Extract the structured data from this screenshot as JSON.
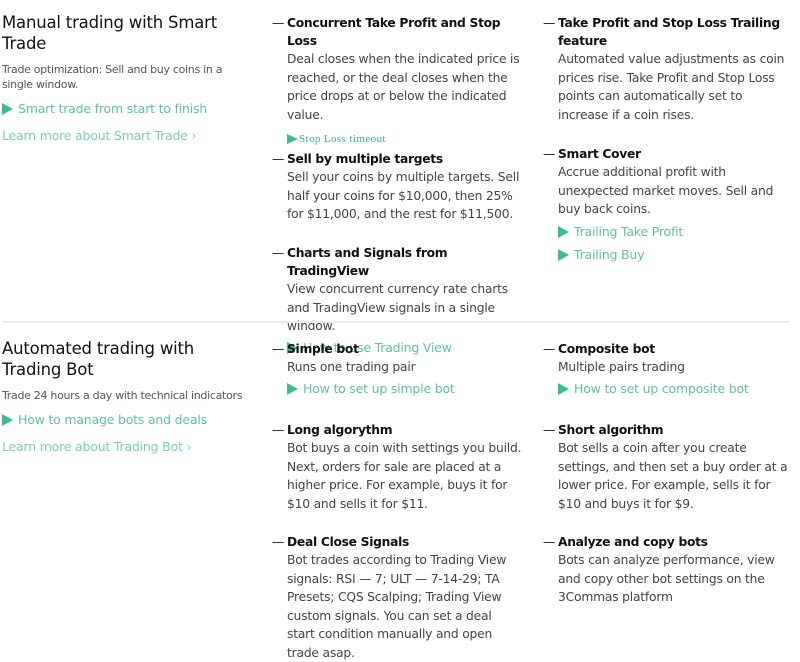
{
  "sections": [
    {
      "title": "Manual trading with Smart Trade",
      "subtitle": "Trade optimization: Sell and buy coins in a single window.",
      "video_link": "Smart trade from start to finish",
      "learn_more": "Learn more about Smart Trade",
      "learn_more_chevron": "›",
      "features": [
        {
          "title": "Concurrent Take Profit and Stop Loss",
          "description": "Deal closes when the indicated price is reached, or the deal closes when the price drops at or below the indicated value.",
          "links": [
            "Stop Loss timeout"
          ]
        },
        {
          "title": "Take Profit and Stop Loss Trailing feature",
          "description": "Automated value adjustments as coin prices rise. Take Profit and Stop Loss points can automatically set to increase if a coin rises.",
          "links": []
        },
        {
          "title": "Sell by multiple targets",
          "description": "Sell your coins by multiple targets. Sell half your coins for $10,000, then 25% for $11,000, and the rest for $11,500.",
          "links": []
        },
        {
          "title": "Smart Cover",
          "description": "Accrue additional profit with unexpected market moves. Sell and buy back coins.",
          "links": [
            "Trailing Take Profit",
            "Trailing Buy"
          ]
        },
        {
          "title": "Charts and Signals from TradingView",
          "description": "View concurrent currency rate charts and TradingView signals in a single window.",
          "links": [
            "How to use Trading View"
          ]
        }
      ]
    },
    {
      "title": "Automated trading with Trading Bot",
      "subtitle": "Trade 24 hours a day with technical indicators",
      "video_link": "How to manage bots and deals",
      "learn_more": "Learn more about Trading Bot",
      "learn_more_chevron": "›",
      "features": [
        {
          "title": "Simple bot",
          "description": "Runs one trading pair",
          "links": [
            "How to set up simple bot"
          ]
        },
        {
          "title": "Composite bot",
          "description": "Multiple pairs trading",
          "links": [
            "How to set up composite bot"
          ]
        },
        {
          "title": "Long algorythm",
          "description": "Bot buys a coin with settings you build. Next, orders for sale are placed at a higher price. For example, buys it for $10 and sells it for $11.",
          "links": []
        },
        {
          "title": "Short algorithm",
          "description": "Bot sells a coin after you create settings, and then set a buy order at a lower price. For example, sells it for $10 and buys it for $9.",
          "links": []
        },
        {
          "title": "Deal Close Signals",
          "description": "Bot trades according to Trading View signals: RSI — 7; ULT — 7-14-29; TA Presets; CQS Scalping; Trading View custom signals. You can set a deal start condition manually and open trade asap.",
          "links": []
        },
        {
          "title": "Analyze and copy bots",
          "description": "Bots can analyze performance, view and copy other bot settings on the 3Commas platform",
          "links": []
        }
      ]
    }
  ],
  "colors": {
    "accent": "#3dbd8e",
    "link": "#62c09c",
    "divider": "#e8edf2"
  },
  "icons": {
    "play": "play-triangle-icon",
    "dash": "—"
  }
}
